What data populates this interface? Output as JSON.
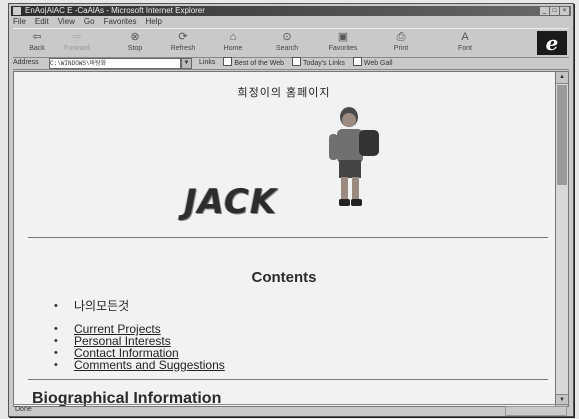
{
  "window": {
    "title": "EnAo|AlAC E -CaAlAs - Microsoft Internet Explorer",
    "controls": [
      "_",
      "□",
      "×"
    ]
  },
  "menu": [
    "File",
    "Edit",
    "View",
    "Go",
    "Favorites",
    "Help"
  ],
  "toolbar": {
    "buttons": [
      {
        "label": "Back",
        "icon": "back-arrow-icon"
      },
      {
        "label": "Forward",
        "icon": "forward-arrow-icon"
      },
      {
        "label": "Stop",
        "icon": "stop-icon"
      },
      {
        "label": "Refresh",
        "icon": "refresh-icon"
      },
      {
        "label": "Home",
        "icon": "home-icon"
      },
      {
        "label": "Search",
        "icon": "search-icon"
      },
      {
        "label": "Favorites",
        "icon": "favorites-icon"
      },
      {
        "label": "Print",
        "icon": "print-icon"
      },
      {
        "label": "Font",
        "icon": "font-icon"
      }
    ],
    "logo": "e"
  },
  "address": {
    "label": "Address",
    "value": "C:\\WINDOWS\\바탕화"
  },
  "links": {
    "label": "Links",
    "items": [
      "Best of the Web",
      "Today's Links",
      "Web Gall"
    ]
  },
  "page": {
    "heading": "희정이의 홈페이지",
    "logo_text": "JACK",
    "contents_title": "Contents",
    "list_first": [
      "나의모든것"
    ],
    "list_links": [
      "Current Projects",
      "Personal Interests",
      "Contact Information",
      "Comments and Suggestions"
    ],
    "section_heading": "Biographical Information"
  },
  "status": {
    "text": "Done"
  }
}
